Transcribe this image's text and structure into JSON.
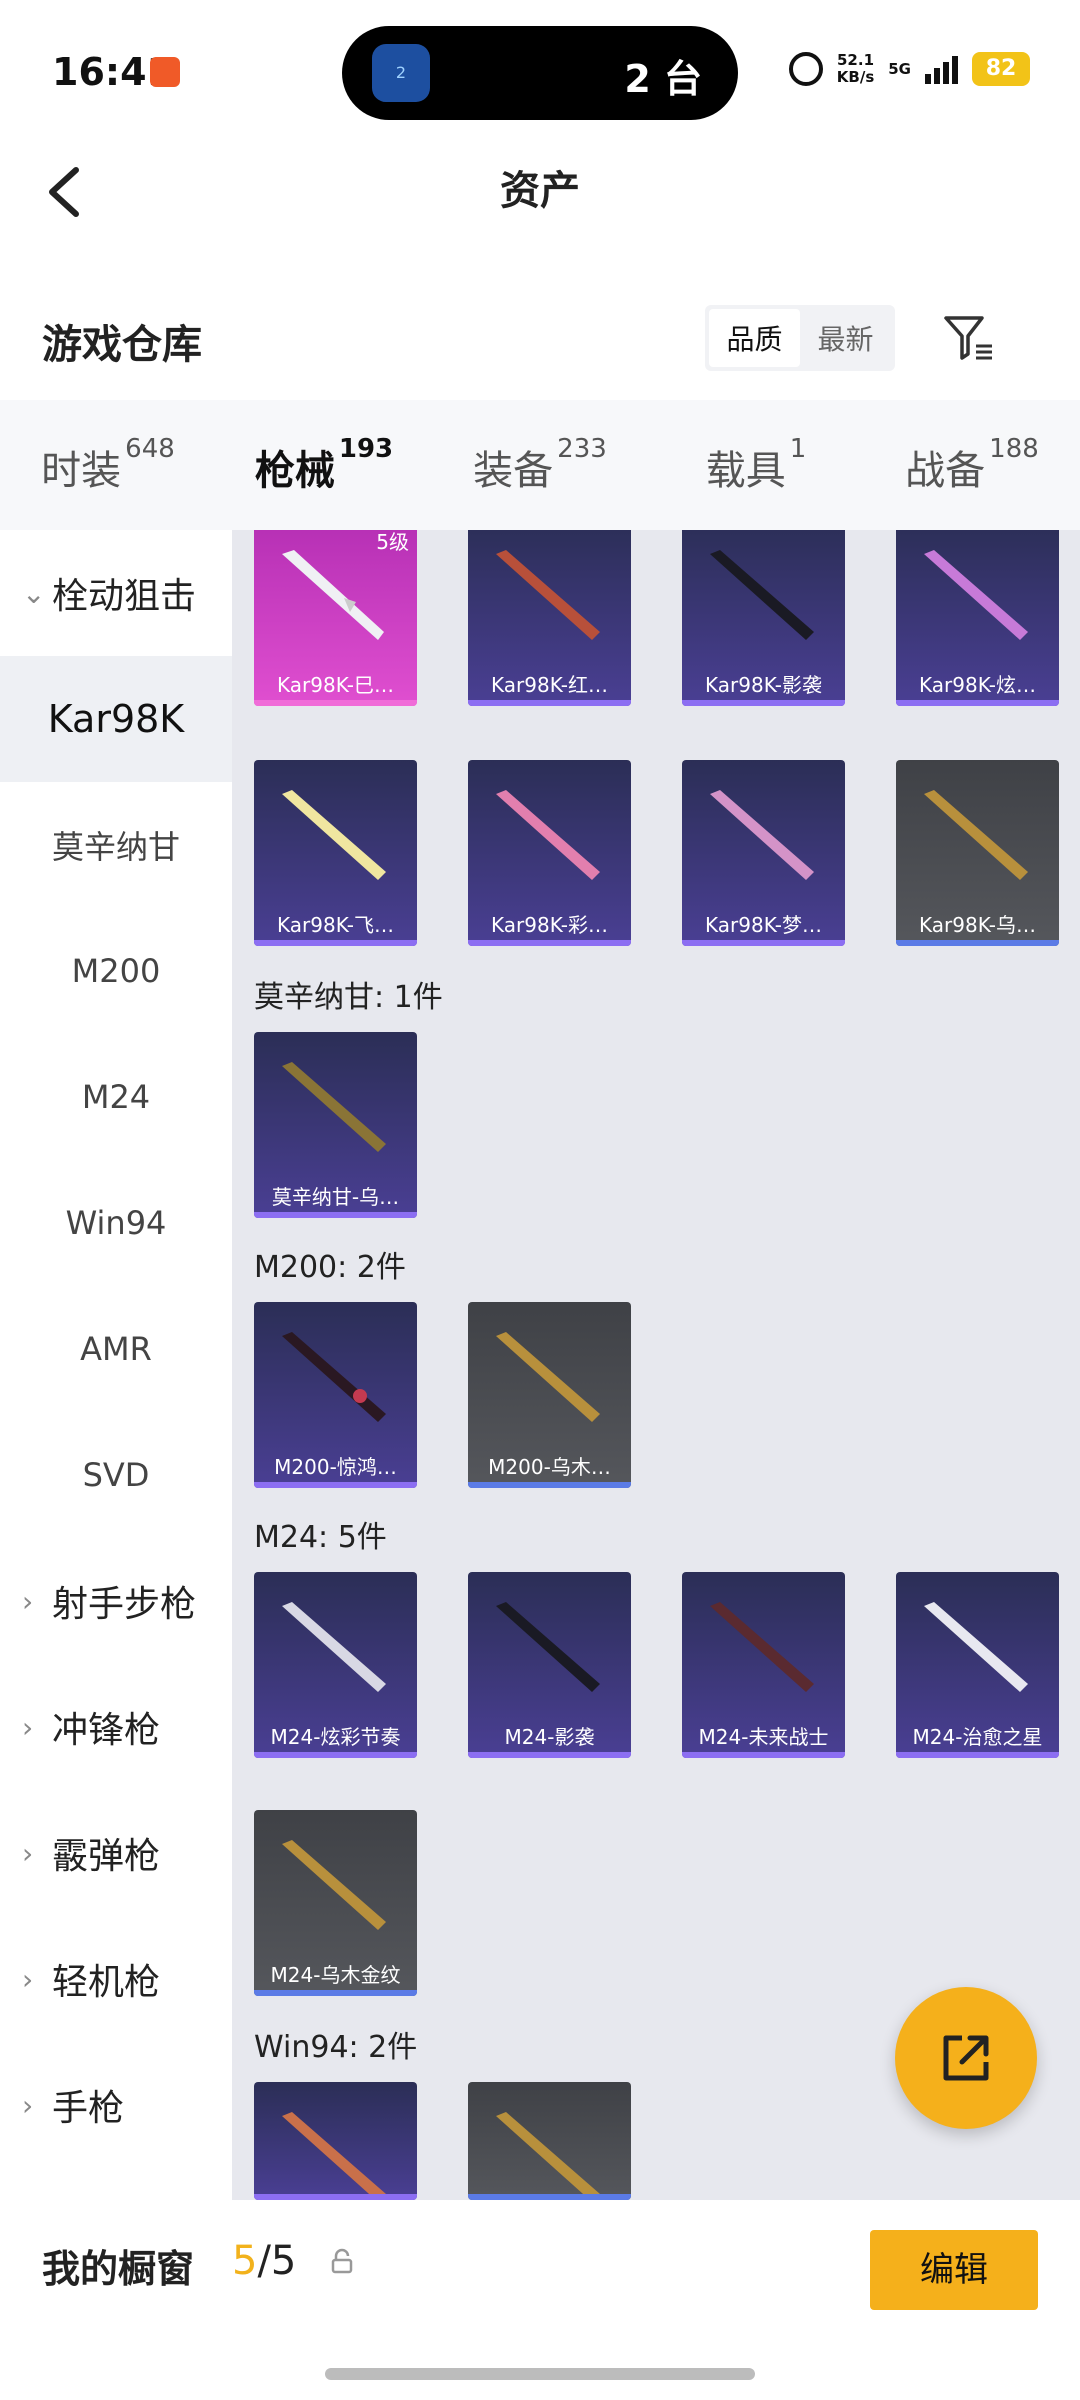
{
  "status": {
    "time": "16:41",
    "island_text": "2 台",
    "island_badge": "2",
    "speed_top": "52.1",
    "speed_bottom": "KB/s",
    "network": "5G",
    "battery": "82"
  },
  "header": {
    "title": "资产"
  },
  "section": {
    "title": "游戏仓库",
    "sort_options": [
      "品质",
      "最新"
    ]
  },
  "tabs": [
    {
      "label": "时装",
      "count": "648"
    },
    {
      "label": "枪械",
      "count": "193"
    },
    {
      "label": "装备",
      "count": "233"
    },
    {
      "label": "载具",
      "count": "1"
    },
    {
      "label": "战备",
      "count": "188"
    }
  ],
  "sidebar": {
    "group_open": "栓动狙击",
    "items": [
      "Kar98K",
      "莫辛纳甘",
      "M200",
      "M24",
      "Win94",
      "AMR",
      "SVD"
    ],
    "groups": [
      "射手步枪",
      "冲锋枪",
      "霰弹枪",
      "轻机枪",
      "手枪"
    ]
  },
  "grid": {
    "kar_cards": [
      "Kar98K-巳…",
      "Kar98K-红…",
      "Kar98K-影袭",
      "Kar98K-炫…",
      "Kar98K-飞…",
      "Kar98K-彩…",
      "Kar98K-梦…",
      "Kar98K-乌…"
    ],
    "kar_level": "5级",
    "mosin_label": "莫辛纳甘: 1件",
    "mosin_cards": [
      "莫辛纳甘-乌…"
    ],
    "m200_label": "M200: 2件",
    "m200_cards": [
      "M200-惊鸿…",
      "M200-乌木…"
    ],
    "m24_label": "M24: 5件",
    "m24_cards": [
      "M24-炫彩节奏",
      "M24-影袭",
      "M24-未来战士",
      "M24-治愈之星",
      "M24-乌木金纹"
    ],
    "win94_label": "Win94: 2件"
  },
  "bottom": {
    "label": "我的橱窗",
    "count_a": "5",
    "count_b": "/5",
    "edit": "编辑"
  }
}
